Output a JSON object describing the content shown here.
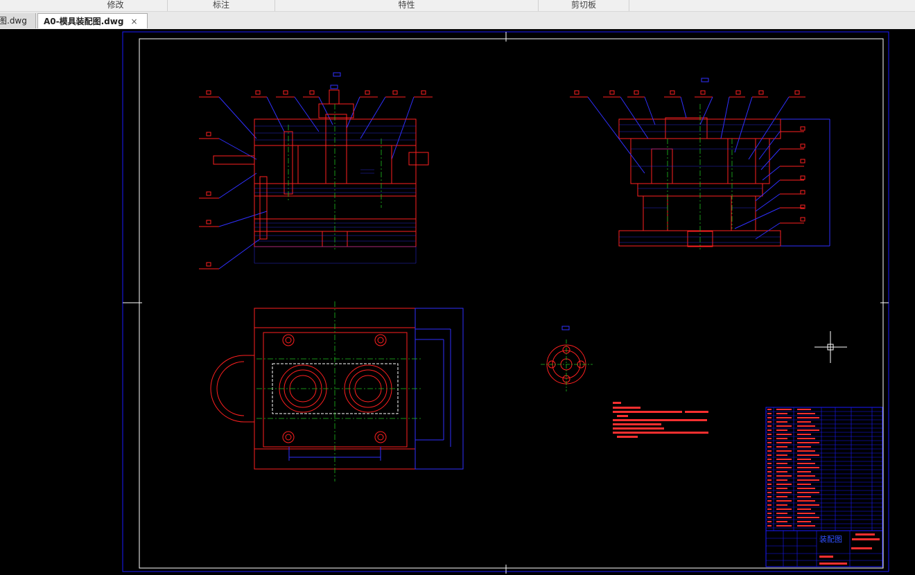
{
  "ribbon": {
    "groups": [
      {
        "label": "修改"
      },
      {
        "label": "标注"
      },
      {
        "label": "特性"
      },
      {
        "label": "剪切板"
      }
    ]
  },
  "tabs": [
    {
      "label": "图.dwg",
      "active": false
    },
    {
      "label": "A0-模具装配图.dwg",
      "active": true
    }
  ],
  "tab_close_symbol": "×",
  "drawing": {
    "title_block_name": "装配图",
    "colors": {
      "frame": "#1a1aff",
      "geometry": "#ff2020",
      "secondary": "#3030ff",
      "center_lines": "#20c020",
      "text": "#ff3030",
      "crosshair": "#ffffff"
    }
  }
}
